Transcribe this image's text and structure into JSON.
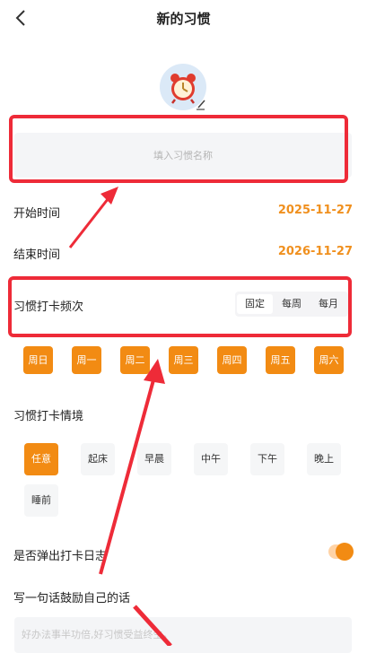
{
  "header": {
    "title": "新的习惯"
  },
  "name_input": {
    "placeholder": "填入习惯名称"
  },
  "start": {
    "label": "开始时间",
    "value": "2025-11-27"
  },
  "end": {
    "label": "结束时间",
    "value": "2026-11-27"
  },
  "frequency": {
    "label": "习惯打卡频次",
    "options": [
      "固定",
      "每周",
      "每月"
    ],
    "selected": "固定"
  },
  "weekdays": [
    "周日",
    "周一",
    "周二",
    "周三",
    "周四",
    "周五",
    "周六"
  ],
  "context": {
    "label": "习惯打卡情境",
    "options": [
      "任意",
      "起床",
      "早晨",
      "中午",
      "下午",
      "晚上",
      "睡前"
    ],
    "selected": "任意"
  },
  "log_popup": {
    "label": "是否弹出打卡日志",
    "enabled": true
  },
  "motto": {
    "label": "写一句话鼓励自己的话",
    "placeholder": "好办法事半功倍,好习惯受益终生。"
  },
  "colors": {
    "accent": "#f28b13",
    "annotation": "#ee2b38",
    "date": "#f0901e"
  }
}
